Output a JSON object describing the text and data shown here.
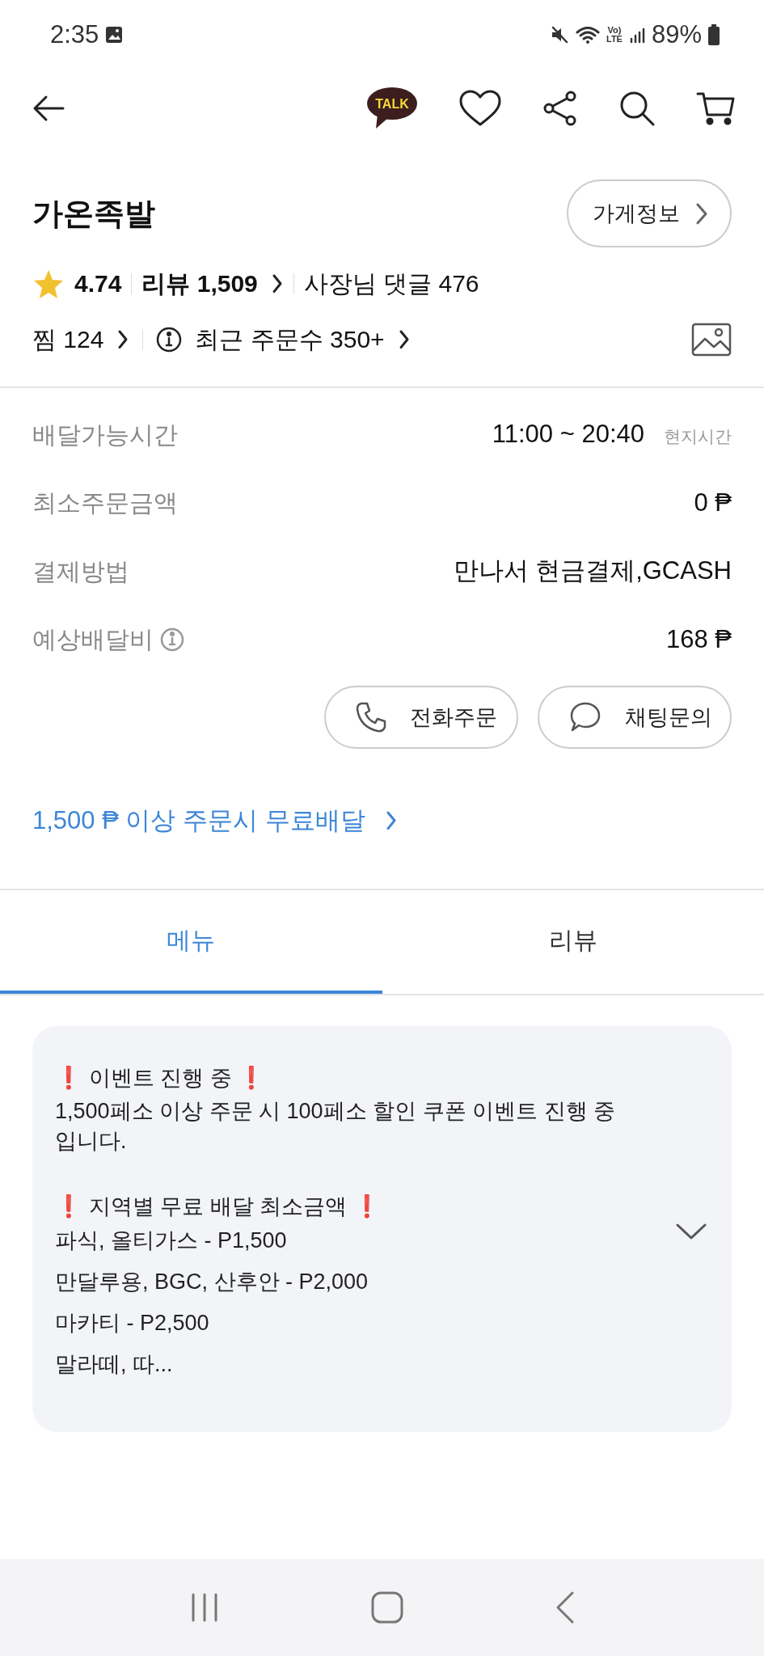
{
  "status_bar": {
    "time": "2:35",
    "network_badge": [
      "Vo)",
      "LTE"
    ],
    "battery": "89%"
  },
  "top_bar": {
    "talk_label": "TALK",
    "liked": false
  },
  "store": {
    "name": "가온족발",
    "info_button": "가게정보",
    "rating": "4.74",
    "reviews": "리뷰 1,509",
    "owner_replies": "사장님 댓글 476",
    "favorites": "찜 124",
    "recent_orders": "최근 주문수 350+"
  },
  "info_rows": [
    {
      "label": "배달가능시간",
      "value": "11:00 ~ 20:40",
      "note": "현지시간",
      "info_icon": false
    },
    {
      "label": "최소주문금액",
      "value": "0 ₱",
      "info_icon": false
    },
    {
      "label": "결제방법",
      "value": "만나서 현금결제,GCASH",
      "info_icon": false
    },
    {
      "label": "예상배달비",
      "value": "168 ₱",
      "info_icon": true
    }
  ],
  "actions": [
    {
      "kind": "phone",
      "label": "전화주문"
    },
    {
      "kind": "chat",
      "label": "채팅문의"
    }
  ],
  "promo": "1,500 ₱ 이상 주문시 무료배달",
  "tabs": [
    {
      "label": "메뉴",
      "selected": true
    },
    {
      "label": "리뷰",
      "selected": false
    }
  ],
  "notice": {
    "expanded": false,
    "lines": [
      {
        "kind": "heading",
        "lead": "❗",
        "text": "이벤트 진행 중",
        "trail": "❗"
      },
      {
        "kind": "text",
        "text": "1,500페소 이상 주문 시 100페소 할인 쿠폰 이벤트 진행 중 입니다."
      },
      {
        "kind": "heading",
        "lead": "❗",
        "text": "지역별 무료 배달 최소금액",
        "trail": "❗"
      },
      {
        "kind": "text",
        "text": "파식, 올티가스 - P1,500"
      },
      {
        "kind": "text",
        "text": "만달루용, BGC, 산후안 - P2,000"
      },
      {
        "kind": "text",
        "text": "마카티 - P2,500"
      },
      {
        "kind": "text",
        "text": "말라떼, 따..."
      }
    ]
  }
}
